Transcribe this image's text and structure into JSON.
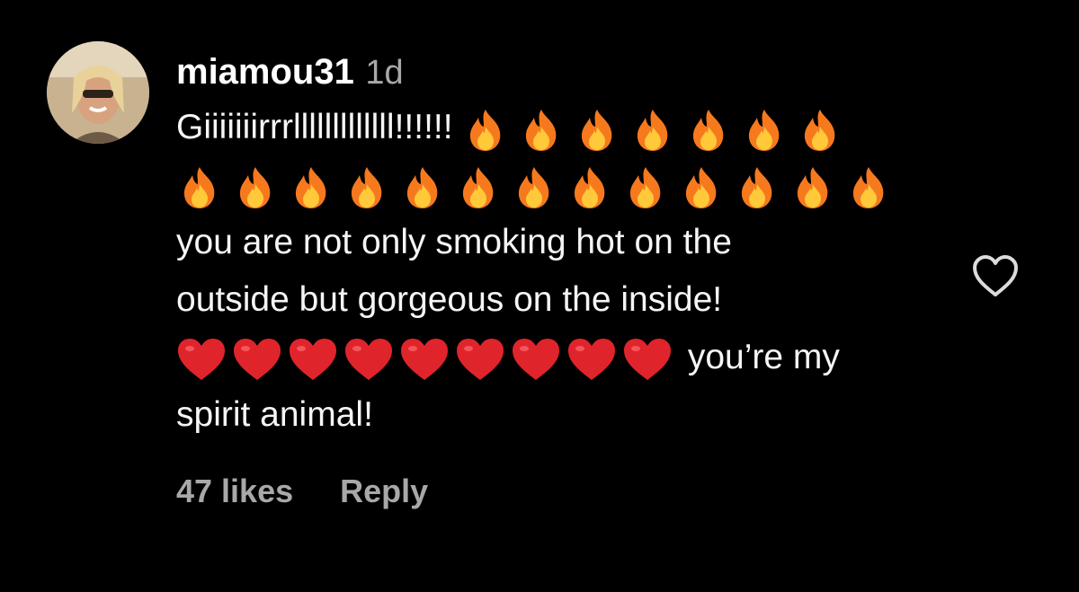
{
  "comment": {
    "username": "miamou31",
    "timestamp": "1d",
    "line1_text": "Giiiiiiirrrlllllllllllll!!!!!!",
    "fire_emojis_line1": 7,
    "fire_emojis_line2": 13,
    "line3_text": "you are not only smoking hot on the",
    "line4_text": "outside but gorgeous on the inside!",
    "heart_emojis_count": 9,
    "line5_text": "you’re my",
    "line6_text": "spirit animal!",
    "likes_label": "47 likes",
    "reply_label": "Reply"
  },
  "icons": {
    "fire": "fire-emoji",
    "heart": "red-heart-emoji",
    "like": "heart-outline-icon",
    "avatar": "user-avatar"
  },
  "colors": {
    "background": "#000000",
    "primary_text": "#ffffff",
    "secondary_text": "#a8a8a8",
    "heart_red": "#e0242c",
    "fire_orange": "#f7791e",
    "fire_yellow": "#ffc93a"
  }
}
